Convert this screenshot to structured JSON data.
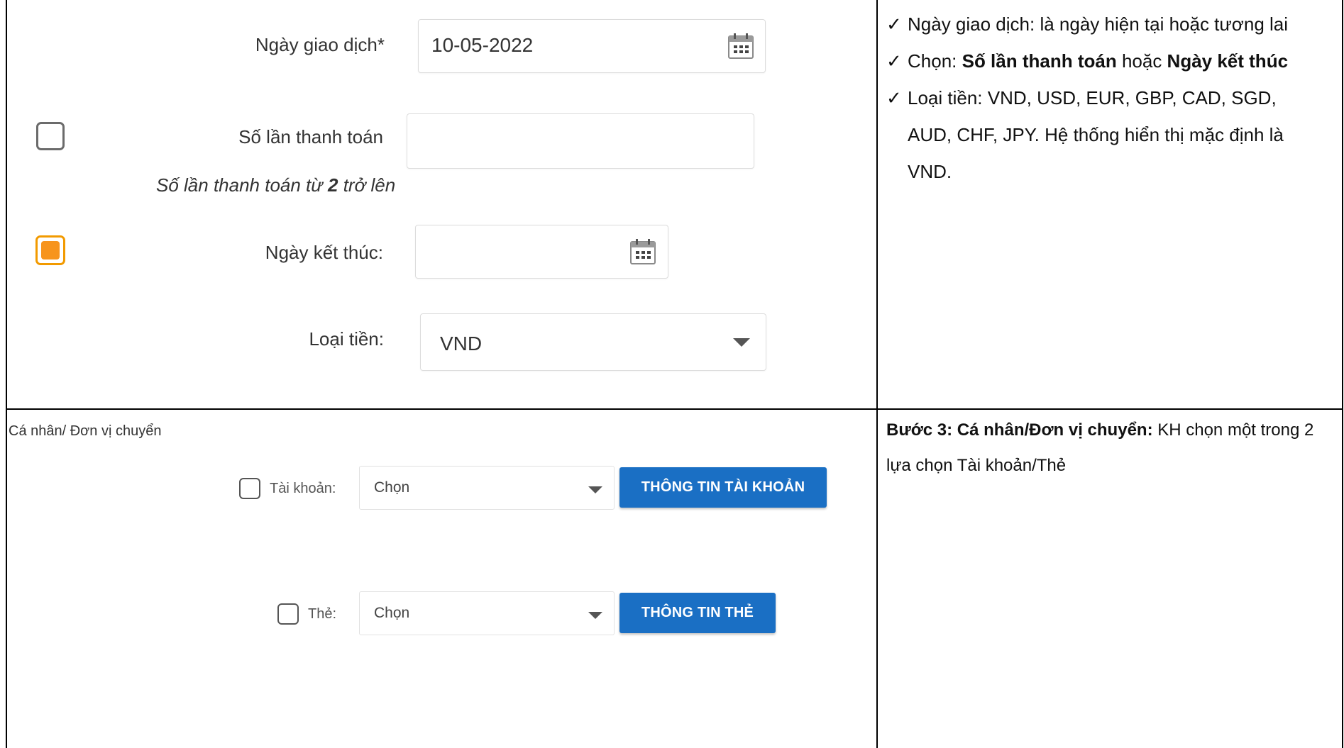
{
  "form_top": {
    "transaction_date": {
      "label": "Ngày giao dịch*",
      "value": "10-05-2022",
      "icon": "calendar-icon"
    },
    "payment_count": {
      "label": "Số lần thanh toán",
      "value": "",
      "hint_prefix": "Số lần thanh toán từ ",
      "hint_number": "2",
      "hint_suffix": " trở lên",
      "checked": false
    },
    "end_date": {
      "label": "Ngày kết thúc:",
      "value": "",
      "icon": "calendar-icon",
      "checked": true
    },
    "currency": {
      "label": "Loại tiền:",
      "value": "VND"
    }
  },
  "notes_top": {
    "tick": "✓",
    "item1": "Ngày giao dịch: là ngày hiện tại hoặc tương lai",
    "item2_prefix": "Chọn: ",
    "item2_bold1": "Số lần thanh toán",
    "item2_mid": " hoặc ",
    "item2_bold2": "Ngày kết thúc",
    "item3": "Loại tiền: VND, USD, EUR, GBP, CAD, SGD, AUD, CHF, JPY. Hệ thống hiển thị mặc định là VND."
  },
  "form_bottom": {
    "section_title": "Cá nhân/ Đơn vị chuyển",
    "account": {
      "label": "Tài khoản:",
      "select_value": "Chọn",
      "button": "THÔNG TIN TÀI KHOẢN"
    },
    "card": {
      "label": "Thẻ:",
      "select_value": "Chọn",
      "button": "THÔNG TIN THẺ"
    }
  },
  "notes_bottom": {
    "bold": "Bước 3: Cá nhân/Đơn vị chuyển:",
    "rest": " KH chọn một trong 2 lựa chọn Tài khoản/Thẻ"
  },
  "colors": {
    "accent_orange": "#f7941d",
    "button_blue": "#1a6fc4"
  }
}
